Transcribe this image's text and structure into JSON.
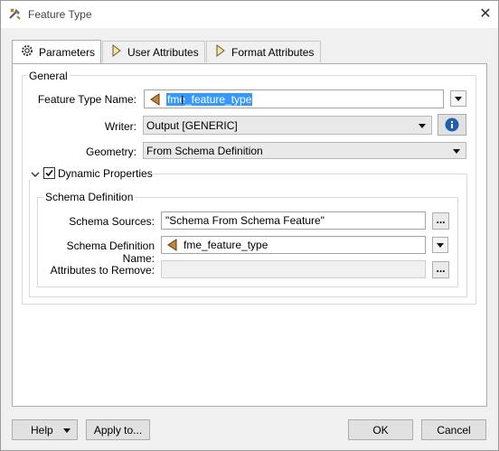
{
  "window": {
    "title": "Feature Type",
    "icon": "fme-tools-icon",
    "close_icon": "close-icon",
    "close_glyph": "✕"
  },
  "tabs": [
    {
      "label": "Parameters",
      "icon": "gear-icon",
      "active": true
    },
    {
      "label": "User Attributes",
      "icon": "attribute-arrow-icon",
      "active": false
    },
    {
      "label": "Format Attributes",
      "icon": "attribute-arrow-icon",
      "active": false
    }
  ],
  "general": {
    "legend": "General",
    "feature_type_name": {
      "label": "Feature Type Name:",
      "value": "fme_feature_type"
    },
    "writer": {
      "label": "Writer:",
      "value": "Output [GENERIC]"
    },
    "geometry": {
      "label": "Geometry:",
      "value": "From Schema Definition"
    }
  },
  "dynamic": {
    "label": "Dynamic Properties",
    "checked": true,
    "schema": {
      "legend": "Schema Definition",
      "sources": {
        "label": "Schema Sources:",
        "value": "\"Schema From Schema Feature\""
      },
      "definition_name": {
        "label": "Schema Definition Name:",
        "value": "fme_feature_type"
      },
      "attributes_to_remove": {
        "label": "Attributes to Remove:",
        "value": ""
      },
      "ellipsis": "..."
    }
  },
  "footer": {
    "help": "Help",
    "apply_to": "Apply to...",
    "ok": "OK",
    "cancel": "Cancel"
  },
  "colors": {
    "selection": "#3399ff",
    "info_blue": "#1f5fb0",
    "icon_orange": "#c8853a"
  }
}
